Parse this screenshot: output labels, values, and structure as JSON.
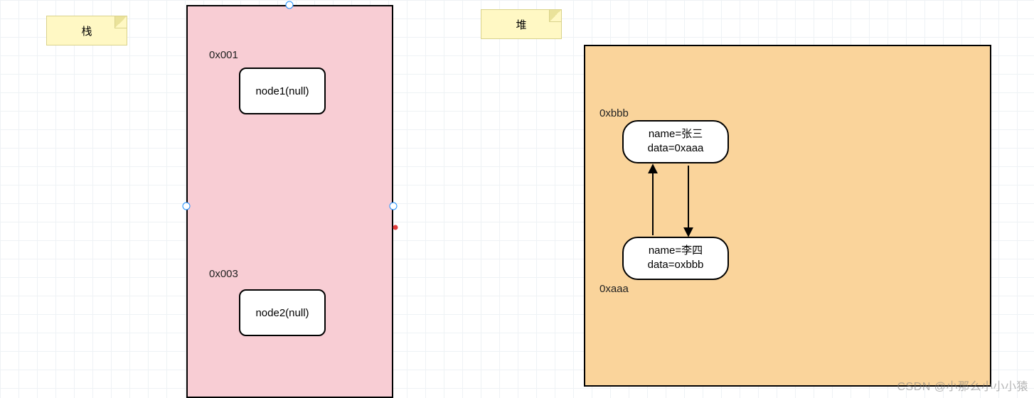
{
  "sticky_stack": "栈",
  "sticky_heap": "堆",
  "stack": {
    "addr1": "0x001",
    "node1": "node1(null)",
    "addr2": "0x003",
    "node2": "node2(null)"
  },
  "heap": {
    "addr_top": "0xbbb",
    "obj_top_line1": "name=张三",
    "obj_top_line2": "data=0xaaa",
    "obj_bot_line1": "name=李四",
    "obj_bot_line2": "data=oxbbb",
    "addr_bot": "0xaaa"
  },
  "watermark": "CSDN @小那么小小小猿"
}
